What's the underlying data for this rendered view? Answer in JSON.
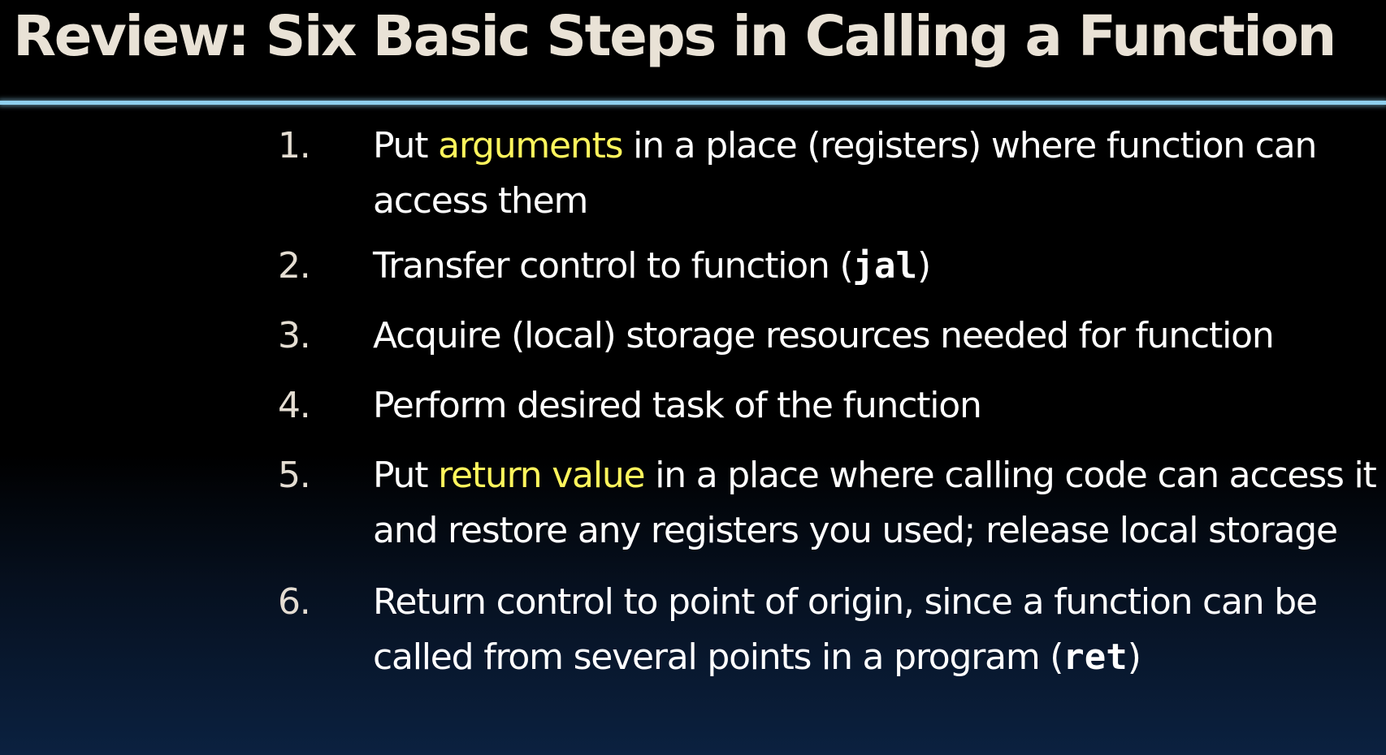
{
  "slide": {
    "title": "Review: Six Basic Steps in Calling a Function",
    "steps": [
      {
        "number": "1.",
        "pre": "Put ",
        "highlight": "arguments",
        "post": " in a place (registers) where function can access them"
      },
      {
        "number": "2.",
        "pre": "Transfer control to function (",
        "code": "jal",
        "post": ")"
      },
      {
        "number": "3.",
        "text": "Acquire (local) storage resources needed for function"
      },
      {
        "number": "4.",
        "text": "Perform desired task of the function"
      },
      {
        "number": "5.",
        "pre": "Put ",
        "highlight": "return value",
        "post": " in a place where calling code can access it and restore any registers you used; release local storage"
      },
      {
        "number": "6.",
        "pre": "Return control to point of origin, since a function can be called from several points in a program (",
        "code": "ret",
        "post": ")"
      }
    ],
    "colors": {
      "title": "#e9e2d6",
      "text": "#ffffff",
      "highlight": "#fff55c",
      "rule": "#8fd0ee",
      "background_top": "#000000",
      "background_bottom": "#0b2140"
    }
  }
}
